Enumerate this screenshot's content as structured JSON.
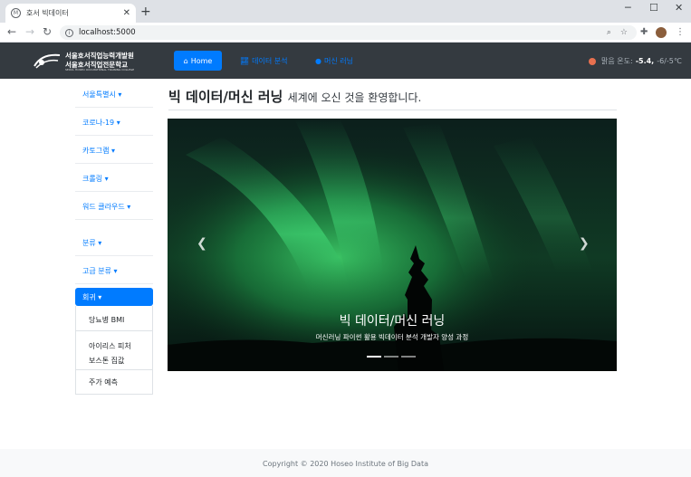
{
  "browser": {
    "tab_title": "호서 빅데이터",
    "url": "localhost:5000"
  },
  "navbar": {
    "logo_line1": "서울호서직업능력개발원",
    "logo_line2": "서울호서직업전문학교",
    "logo_line3": "SEOUL HOSEO OCCUPATIONAL TRAINING COLLEGE",
    "home_label": "Home",
    "data_analysis_label": "데이터 분석",
    "machine_learning_label": "머신 러닝",
    "weather_label": "맑음 온도:",
    "weather_temp": "-5.4,",
    "weather_range": "-6/-5℃"
  },
  "sidebar": {
    "items": [
      {
        "label": "서울특별시"
      },
      {
        "label": "코로나-19"
      },
      {
        "label": "카토그램"
      },
      {
        "label": "크롤링"
      },
      {
        "label": "워드 클라우드"
      },
      {
        "label": "분류"
      },
      {
        "label": "고급 분류"
      },
      {
        "label": "회귀"
      }
    ],
    "submenu": [
      {
        "label": "당뇨병 BMI"
      },
      {
        "label": "아이리스 피처"
      },
      {
        "label": "보스톤 집값"
      },
      {
        "label": "주가 예측"
      }
    ]
  },
  "main": {
    "title": "빅 데이터/머신 러닝",
    "subtitle": "세계에 오신 것을 환영합니다.",
    "carousel": {
      "caption_title": "빅 데이터/머신 러닝",
      "caption_text": "머신러닝 파이썬 활용 빅데이터 분석 개발자 양성 과정",
      "slides": 3,
      "active": 0
    }
  },
  "footer": {
    "copyright": "Copyright © 2020 Hoseo Institute of Big Data"
  },
  "colors": {
    "primary": "#007bff",
    "navbar_bg": "#343a40",
    "weather_dot": "#e8704f"
  }
}
